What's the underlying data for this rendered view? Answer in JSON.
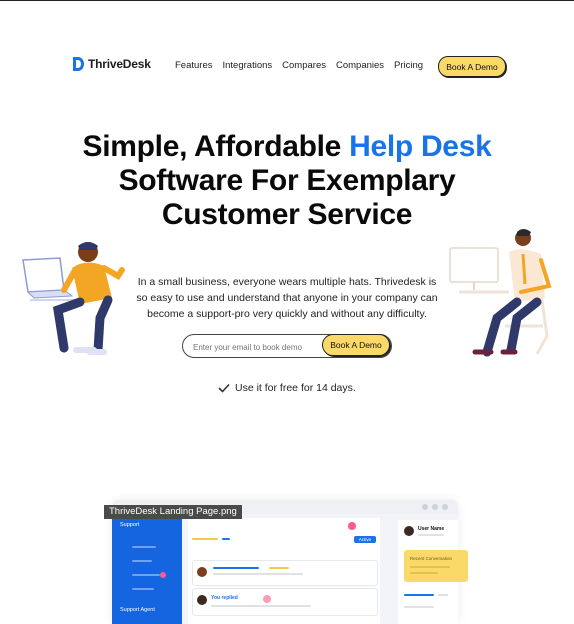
{
  "brand": {
    "name": "ThriveDesk",
    "color": "#1a73e8"
  },
  "nav": {
    "links": [
      "Features",
      "Integrations",
      "Compares",
      "Companies",
      "Pricing"
    ],
    "cta": "Book A Demo"
  },
  "hero": {
    "title_part1": "Simple, Affordable ",
    "title_accent": "Help Desk",
    "title_line2": "Software For Exemplary",
    "title_line3": "Customer Service",
    "subtitle": "In a small business, everyone wears multiple hats. Thrivedesk is so easy to use and understand that anyone in your company can become a support-pro very quickly and without any difficulty.",
    "email_placeholder": "Enter your email to book demo",
    "cta": "Book A Demo",
    "free_note": "Use it for free for 14 days."
  },
  "screenshot": {
    "caption": "ThriveDesk Landing Page.png",
    "sidebar_top": "Support",
    "sidebar_bottom": "Support Agent",
    "replied_label": "You replied",
    "user_name": "User Name",
    "active_label": "Active",
    "notify_title": "Recent Conversation"
  },
  "colors": {
    "accent": "#1a73e8",
    "cta": "#fbd968",
    "sidebar": "#1565e0"
  }
}
